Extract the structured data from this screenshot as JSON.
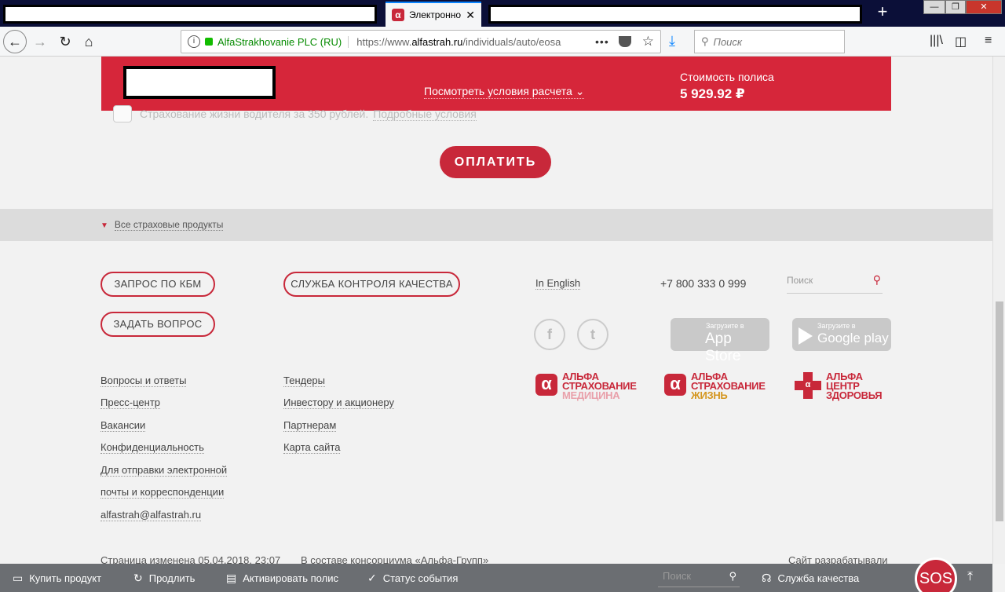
{
  "browser": {
    "active_tab_title": "Электронно",
    "identity": "AlfaStrakhovanie PLC (RU)",
    "url_prefix": "https://www.",
    "url_domain": "alfastrah.ru",
    "url_path": "/individuals/auto/eosa",
    "search_placeholder": "Поиск",
    "icons": {
      "back": "arrow-left",
      "forward": "arrow-right",
      "reload": "reload",
      "home": "home",
      "download": "download-arrow",
      "library": "library",
      "sidebar": "sidebar",
      "menu": "hamburger"
    }
  },
  "summary_bar": {
    "terms_link": "Посмотреть условия расчета",
    "cost_label": "Стоимость полиса",
    "cost_value": "5 929.92 ₽",
    "accent_color": "#d6263a"
  },
  "option_row": {
    "text": "Страхование жизни водителя за 350 рублей.",
    "link": "Подробные условия"
  },
  "pay_button": "ОПЛАТИТЬ",
  "products_bar": "Все страховые продукты",
  "footer": {
    "pills": {
      "kbm": "ЗАПРОС ПО КБМ",
      "quality": "СЛУЖБА КОНТРОЛЯ КАЧЕСТВА",
      "ask": "ЗАДАТЬ ВОПРОС"
    },
    "english": "In English",
    "phone": "+7 800 333 0 999",
    "search_placeholder": "Поиск",
    "links_col1": [
      "Вопросы и ответы",
      "Пресс-центр",
      "Вакансии",
      "Конфиденциальность",
      "Для отправки электронной",
      "почты и корреспонденции",
      "alfastrah@alfastrah.ru"
    ],
    "links_col2": [
      "Тендеры",
      "Инвестору и акционеру",
      "Партнерам",
      "Карта сайта"
    ],
    "app_store": {
      "small": "Загрузите в",
      "big": "App Store"
    },
    "google_play": {
      "small": "Загрузите в",
      "big": "Google play"
    },
    "brands": [
      {
        "line1": "АЛЬФА",
        "line2": "СТРАХОВАНИЕ",
        "line3": "МЕДИЦИНА"
      },
      {
        "line1": "АЛЬФА",
        "line2": "СТРАХОВАНИЕ",
        "line3": "ЖИЗНЬ"
      },
      {
        "line1": "АЛЬФА",
        "line2": "ЦЕНТР",
        "line3": "ЗДОРОВЬЯ"
      }
    ],
    "modified": "Страница изменена 05.04.2018, 23:07",
    "consortium": "В составе консорциума «Альфа-Групп»",
    "developed": "Сайт разрабатывали"
  },
  "bottom_bar": {
    "buy": "Купить продукт",
    "extend": "Продлить",
    "activate": "Активировать полис",
    "status": "Статус события",
    "search_placeholder": "Поиск",
    "quality": "Служба качества",
    "sos": "SOS"
  }
}
